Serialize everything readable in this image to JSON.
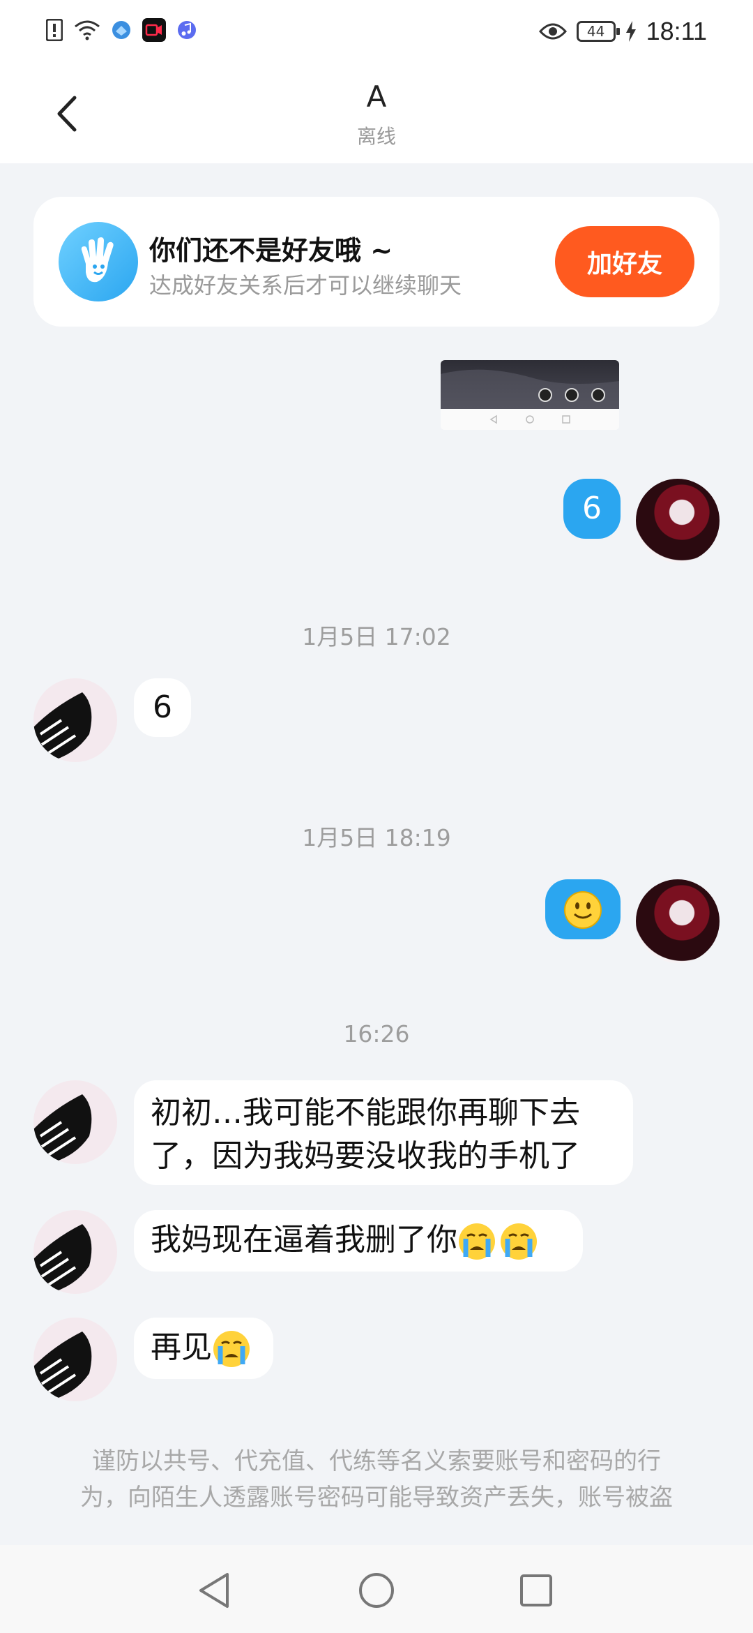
{
  "status_bar": {
    "time": "18:11",
    "battery": "44",
    "icons": [
      "alert-icon",
      "wifi-icon",
      "app-icon",
      "video-recorder-icon",
      "music-icon",
      "eye-icon",
      "charging-icon"
    ]
  },
  "header": {
    "title": "A",
    "subtitle": "离线"
  },
  "friend_banner": {
    "title": "你们还不是好友哦 ~",
    "description": "达成好友关系后才可以继续聊天",
    "button_label": "加好友"
  },
  "messages": [
    {
      "side": "out",
      "type": "image"
    },
    {
      "side": "out",
      "text": "6"
    },
    {
      "timestamp": "1月5日 17:02"
    },
    {
      "side": "in",
      "text": "6"
    },
    {
      "timestamp": "1月5日 18:19"
    },
    {
      "side": "out",
      "type": "emoji",
      "emoji": "slightly-smiling-face"
    },
    {
      "timestamp": "16:26"
    },
    {
      "side": "in",
      "text_line1": "初初…我可能不能跟你再聊下去",
      "text_line2": "了，因为我妈要没收我的手机了"
    },
    {
      "side": "in",
      "text": "我妈现在逼着我删了你",
      "emoji": "crying-face"
    },
    {
      "side": "in",
      "text": "再见",
      "emoji": "crying-face"
    }
  ],
  "warning": {
    "line1": "谨防以共号、代充值、代练等名义索要账号和密码的行",
    "line2": "为，向陌生人透露账号密码可能导致资产丢失，账号被盗"
  },
  "colors": {
    "accent_blue": "#2ba6f0",
    "add_button": "#ff5a1f",
    "background": "#f2f4f7"
  }
}
